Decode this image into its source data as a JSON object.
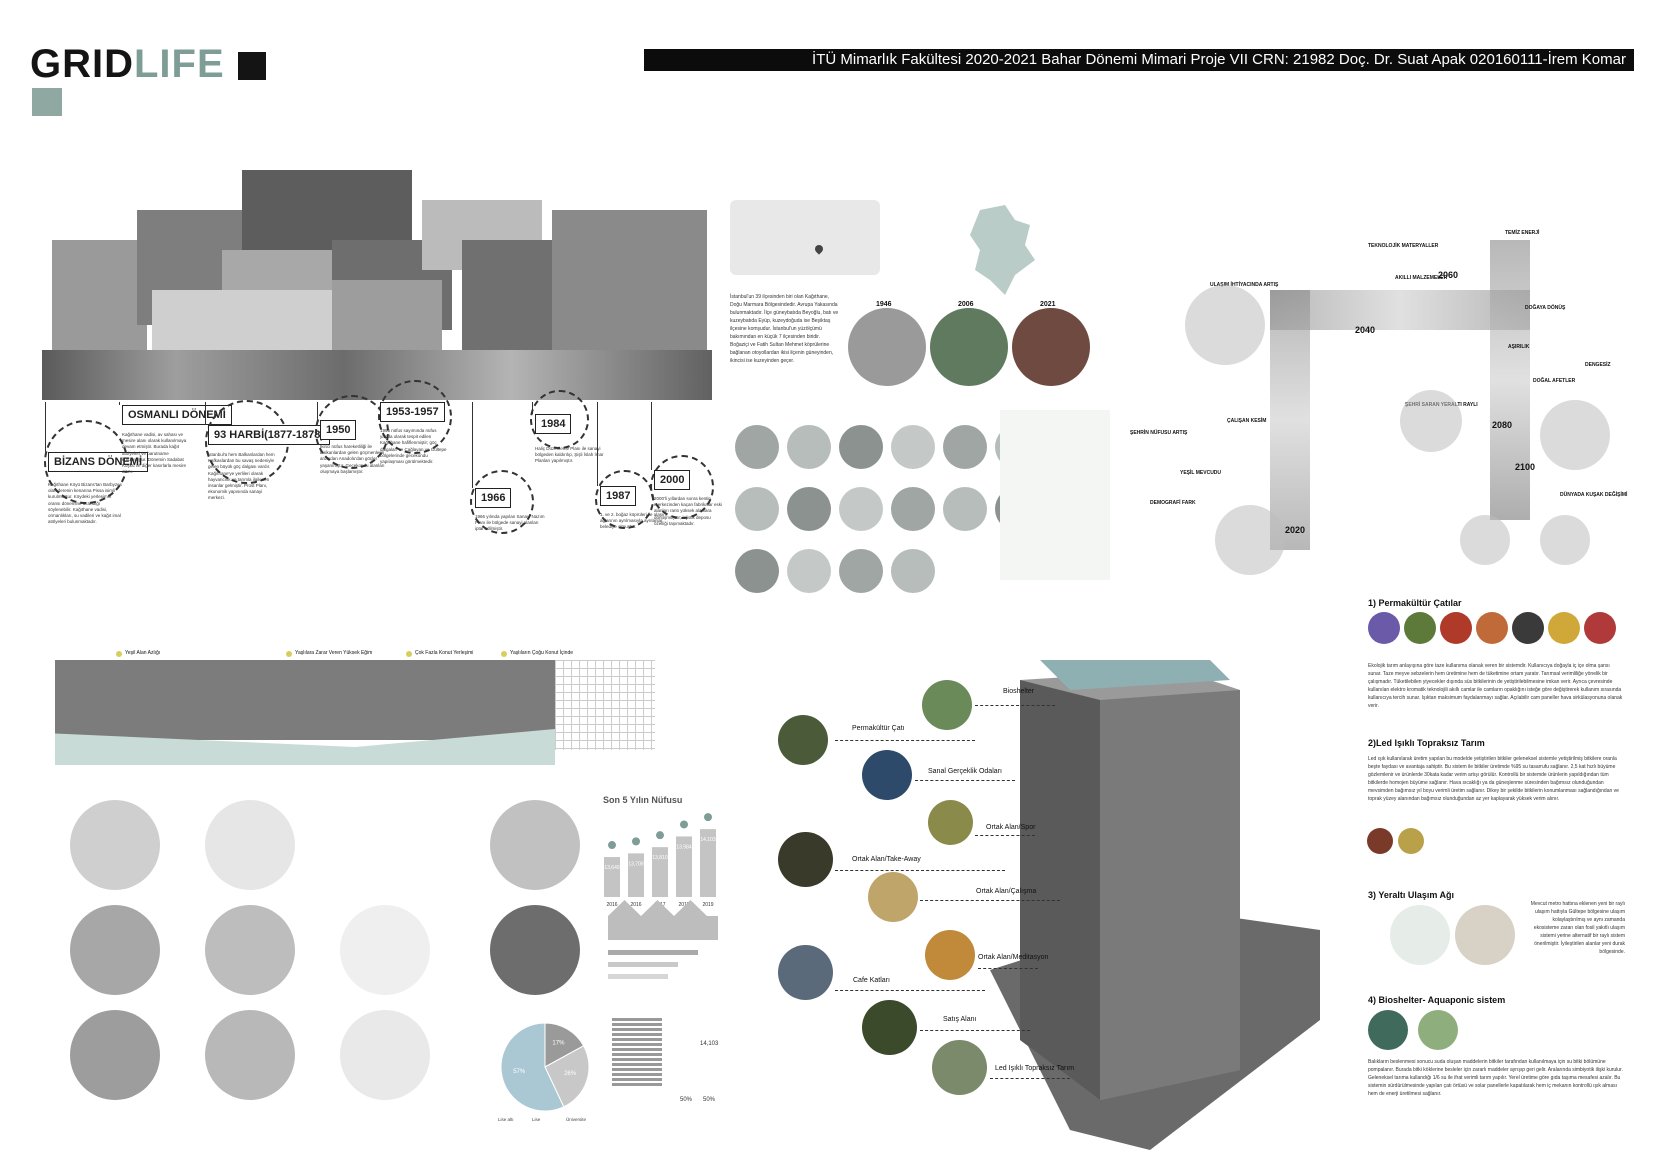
{
  "logo": {
    "part1": "GRID",
    "part2": "LIFE"
  },
  "header": {
    "text": "İTÜ Mimarlık Fakültesi   2020-2021 Bahar Dönemi   Mimari Proje VII  CRN: 21982  Doç. Dr. Suat Apak  020160111-İrem Komar"
  },
  "timeline": {
    "eras": [
      {
        "label": "BİZANS DÖNEMİ",
        "text": "Kağıthane Köyü Bizans'tan Barbyzes olan derenin kenarına Pissa isimli kurulmuştur. Köydeki yerleşimin oransı dönemine uzandığı söylenebilir. Kağıthane vadisi, ormanlıkları, su vadileri ve kağıt imal atölyeleri bulunmaktadır."
      },
      {
        "label": "OSMANLI DÖNEMİ",
        "text": "Kağıthane vadisi, av sahası ve mesire alanı olarak kullanılmaya devam etmiştir. Burada kağıt atölyeleri ve barutname kurulmuştur. Dönemin Sadabat Köşkü ve diğer kasırlarla mesire alanı."
      },
      {
        "label": "93 HARBİ(1877-1878)",
        "text": "İstanbul'a hem Balkanlardan hem Kafkaslardan bu savaş nedeniyle gelen büyük göç dalgası vardır. Kağıthane'ye yerlileri olarak hayvancılık ve tarımla ilgilenen insanlar gelmiştir. Prost Planı, ekonomik yapısında sanayi merkezi."
      },
      {
        "label": "1950",
        "text": "İkinci nüfus hareketliliği ile Balkanlardan gelen göçmenlerin ardından Anadolu'dan göçler yaşanmıştır. Gecekondu alanları oluşmaya başlamıştır."
      },
      {
        "label": "1953-1957",
        "text": "1955 nüfus sayımında nüfus yarıda olarak tespit edilen Kağıthane hafiflenmiştir; göç dalgaları ve Çağlayan ve Gültepe bölgelerinde gecekondu yapılaşması görülmektedir."
      },
      {
        "label": "1966",
        "text": "1966 yılında yapılan Sanayi Nazım Planı ile bölgede sanayi alanları iptal edilmiştir."
      },
      {
        "label": "1984",
        "text": "Haliç Düzenleme Planı ile sanayi bölgeden kaldırılıp, Şişli İslah İmar Planları yapılmıştır."
      },
      {
        "label": "1987",
        "text": "1. ve 2. boğaz köprüleri ile ulaşım ağlarının ayrılmasıyla ayrılanlar belediye olmuştur."
      },
      {
        "label": "2000",
        "text": "2000'li yıllardan sonra kentin merkezinden kaçan fabrikalar eski alanları rantı yüksek alanlara dönüşmüştür; lojistik deposu özelliği taşımaktadır."
      }
    ]
  },
  "map_section": {
    "text": "İstanbul'un 39 ilçesinden biri olan Kağıthane, Doğu Marmara Bölgesindedir. Avrupa Yakasında bulunmaktadır. İlçe güneybatıda Beyoğlu, batı ve kuzeybatıda Eyüp, kuzeydoğuda ise Beşiktaş ilçesine komşudur. İstanbul'un yüzölçümü bakımından en küçük 7 ilçesinden biridir. Boğaziçi ve Fatih Sultan Mehmet köprülerine bağlanan otoyollardan ikisi ilçenin güneyinden, ikincisi ise kuzeyinden geçer.",
    "years": [
      "1946",
      "2006",
      "2021"
    ]
  },
  "diagram": {
    "labels": [
      "ULAŞIM İHTİYACINDA ARTIŞ",
      "TEKNOLOJİK MATERYALLER",
      "AKILLI MALZEMELER",
      "TEMİZ ENERJİ",
      "DOĞAYA DÖNÜŞ",
      "AŞIRILIK",
      "DENGESİZ",
      "DOĞAL AFETLER",
      "DÜNYADA KUŞAK DEĞİŞİMİ",
      "ŞEHRİ SARAN YERALTI RAYLI",
      "ÇALIŞAN KESİM",
      "ŞEHRİN NÜFUSU ARTIŞ",
      "YEŞİL MEVCUDU",
      "DEMOGRAFİ FARK"
    ],
    "years": [
      "2020",
      "2040",
      "2060",
      "2080",
      "2100"
    ]
  },
  "street_section": {
    "labels": [
      "Yeşil Alan Azlığı",
      "Yaşlılara Zarar Veren Yüksek Eğim",
      "Çok Fazla Konut Yerleşimi",
      "Yaşlıların Çoğu Konut İçinde"
    ]
  },
  "population": {
    "title": "Son 5 Yılın Nüfusu",
    "years": [
      "2016",
      "2016",
      "2017",
      "2018",
      "2019"
    ],
    "values": [
      13649,
      13709,
      13810,
      13984,
      14103
    ],
    "value_labels": [
      "13,649",
      "13,709",
      "13,810",
      "13,984",
      "14,103"
    ],
    "pie_values": [
      17,
      26,
      57
    ],
    "pie_labels": [
      "17%",
      "26%",
      "57%"
    ],
    "pie_legend": [
      "Lise altı",
      "Lise",
      "Üniversite"
    ],
    "pct_labels": [
      "50%",
      "50%"
    ],
    "total": "14,103"
  },
  "building": {
    "labels": [
      "Bioshelter",
      "Permakültür Çatı",
      "Sanal Gerçeklik Odaları",
      "Ortak Alan/Spor",
      "Ortak Alan/Take-Away",
      "Ortak Alan/Çalışma",
      "Ortak Alan/Meditasyon",
      "Cafe Katları",
      "Satış Alanı",
      "Led Işıklı Topraksız Tarım"
    ]
  },
  "right_text": {
    "s1_title": "1) Permakültür Çatılar",
    "s1_text": "Ekolojik tarım anlayışına göre taze kullanıma olanak veren bir sistemdir. Kullanıcıya doğayla iç içe olma şansı sunar. Taze meyve sebzelerin hem üretimine hem de tüketimine ortam yaratır. Tarımsal verimliliğe yönelik bir çalışmadır. Tüketilebilen yiyecekler dışında süs bitkilerinin de yetiştirilebilmesine imkan verir. Ayrıca çevresinde kullanılan elektro kromatik teknolojili akıllı camlar ile camların opaklığını isteğe göre değiştirerek kullanım sırasında kullanıcıya tercih sunar. Işıktan maksimum faydalanmayı sağlar. Açılabilir cam paneller hava sirkülasyonuna olanak verir.",
    "s2_title": "2)Led Işıklı Topraksız Tarım",
    "s2_text": "Led ışık kullanılarak üretim yapılan bu modelde yetiştirilen bitkiler geleneksel sistemle yetiştirilmiş bitkilere oranla beşte faydası ve avantaja sahiptir. Bu sistem ile bitkiler üretimde %95 su tasarrufu sağlanır. 2,5 kat hızlı büyüme gözlemlenir ve ürünlerde 30kata kadar verim artışı görülür. Kontrollü bir sistemde ürünlerin yapıldığından tüm bitkilerde homojen büyüme sağlanır. Hava sıcaklığı ya da güneşlenme süresinden bağımsız olunduğundan mevsimden bağımsız yıl boyu verimli üretim sağlanır. Dikey bir şekilde bitkilerin konumlanması sağlandığından ve toprak yüzey alanından bağımsız olunduğundan az yer kaplayarak yüksek verim alınır.",
    "s3_title": "3) Yeraltı Ulaşım Ağı",
    "s3_text": "Mevcut metro hattına eklenen yeni bir raylı ulaşım hattıyla Gültepe bölgesine ulaşım kolaylaştırılmış ve aynı zamanda ekosisteme zararı olan fosil yakıtlı ulaşım sistemi yerine alternatif bir raylı sistem önerilmiştir. İyileştirilen alanlar yeni durak bölgesinde.",
    "s4_title": "4) Bioshelter- Aquaponic sistem",
    "s4_text": "Balıkların beslenmesi sonucu suda oluşan maddelerin bitkiler tarafından kullanılmaya için su bitki bölümüne pompalanır. Burada bitki köklerine besleler için zararlı maddeler ayrışıp geri gelir. Aralarında simbiyotik ilişki kurulur. Geleneksel tarıma kullandığı 1/6 su ile ifrat verimli tarım yapılır. Yerel üretime göre gıda taşıma mesafesi azalır. Bu sistemin sürdürülmesinde yapılan çatı örtüsü ve solar panellerle kapatılarak hem iç mekanın kontrollü ışık alması hem de enerji üretilmesi sağlanır."
  },
  "colors": {
    "accent": "#7f9d97",
    "dark": "#141414",
    "header_bg": "#0c0c0c",
    "sage": "#b9ccc7"
  }
}
